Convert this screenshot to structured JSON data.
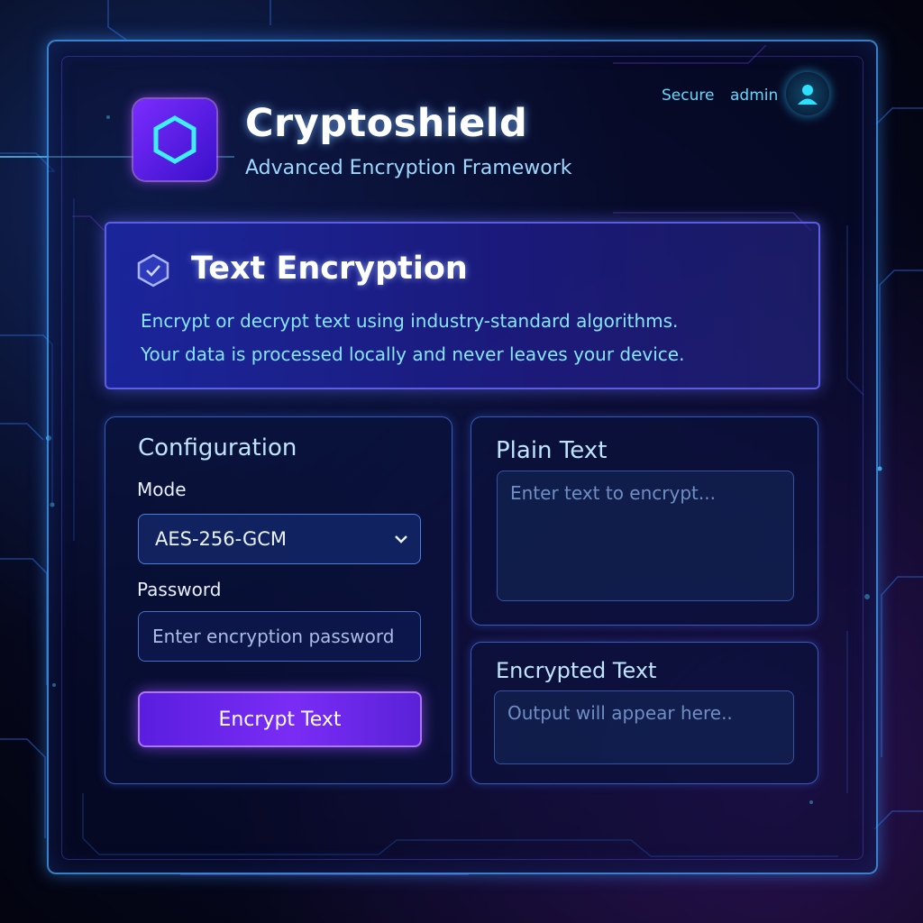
{
  "app": {
    "title": "Cryptoshield",
    "subtitle": "Advanced Encryption Framework",
    "logo_icon": "hexagon-icon"
  },
  "status": {
    "security": "Secure",
    "user": "admin",
    "avatar_icon": "user-icon"
  },
  "banner": {
    "title": "Text Encryption",
    "icon": "shield-check-icon",
    "line1": "Encrypt or decrypt text using industry-standard algorithms.",
    "line2": "Your data is processed locally and never leaves your device."
  },
  "config": {
    "title": "Configuration",
    "mode_label": "Mode",
    "mode_value": "AES-256-GCM",
    "password_label": "Password",
    "password_placeholder": "Enter encryption password",
    "encrypt_button": "Encrypt Text"
  },
  "plain": {
    "title": "Plain Text",
    "placeholder": "Enter text to encrypt..."
  },
  "encrypted": {
    "title": "Encrypted Text",
    "placeholder": "Output will appear here.."
  },
  "colors": {
    "accent_cyan": "#62d8ff",
    "accent_purple": "#7a2cf5",
    "frame_blue": "#46aaff",
    "background": "#05071a"
  }
}
